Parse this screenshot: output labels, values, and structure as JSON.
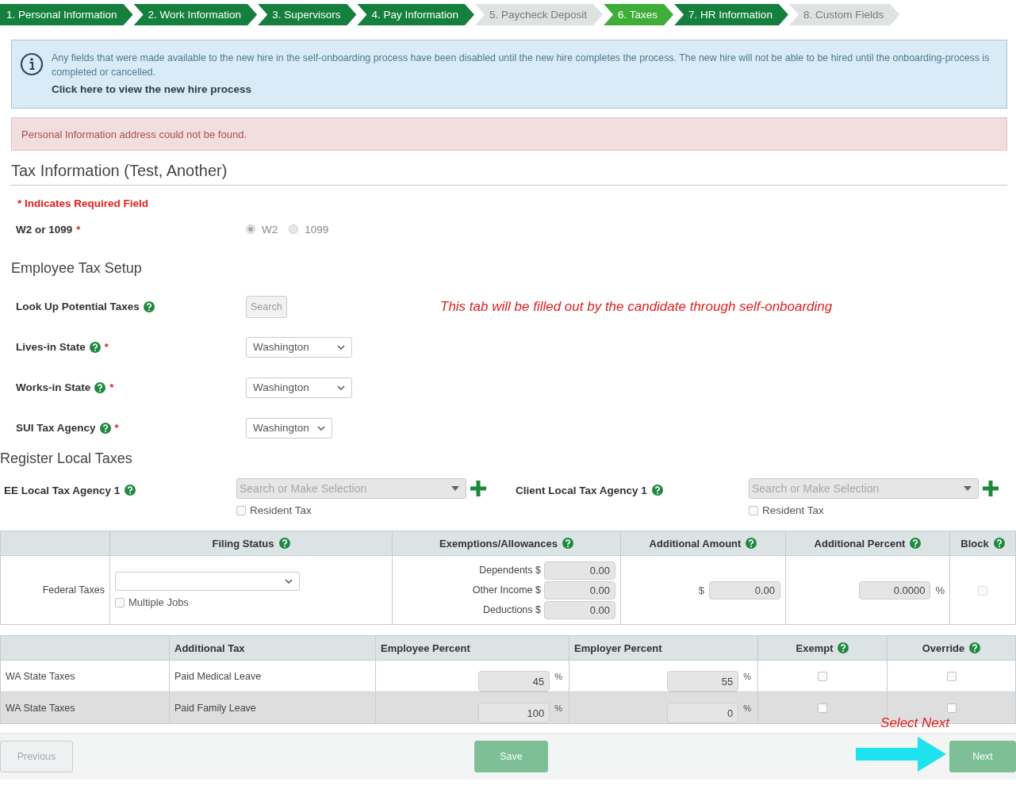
{
  "steps": [
    {
      "label": "1. Personal Information",
      "completed": true,
      "selected": false
    },
    {
      "label": "2. Work Information",
      "completed": true,
      "selected": false
    },
    {
      "label": "3. Supervisors",
      "completed": true,
      "selected": false
    },
    {
      "label": "4. Pay Information",
      "completed": true,
      "selected": false
    },
    {
      "label": "5. Paycheck Deposit",
      "completed": false,
      "selected": false
    },
    {
      "label": "6. Taxes",
      "completed": false,
      "selected": true
    },
    {
      "label": "7. HR Information",
      "completed": true,
      "selected": false
    },
    {
      "label": "8. Custom Fields",
      "completed": false,
      "selected": false
    }
  ],
  "info_alert": {
    "text": "Any fields that were made available to the new hire in the self-onboarding process have been disabled until the new hire completes the process. The new hire will not be able to be hired until the onboarding-process is completed or cancelled.",
    "link": "Click here to view the new hire process"
  },
  "error_alert": {
    "text": "Personal Information address could not be found."
  },
  "title": "Tax Information (Test, Another)",
  "required_note": "* Indicates Required Field",
  "worker_type": {
    "label": "W2 or 1099",
    "required_mark": "*",
    "options": [
      {
        "label": "W2",
        "selected": true,
        "disabled": true
      },
      {
        "label": "1099",
        "selected": false,
        "disabled": true
      }
    ]
  },
  "tax_setup": {
    "heading": "Employee Tax Setup",
    "note": "This tab will be filled out by the candidate through self-onboarding",
    "rows": [
      {
        "kind": "button",
        "label": "Look Up Potential Taxes",
        "help": true,
        "button": "Search"
      },
      {
        "kind": "select",
        "label": "Lives-in State",
        "help": true,
        "required_mark": "*",
        "value": "Washington"
      },
      {
        "kind": "select",
        "label": "Works-in State",
        "help": true,
        "required_mark": "*",
        "value": "Washington"
      },
      {
        "kind": "select",
        "label": "SUI Tax Agency",
        "help": true,
        "required_mark": "*",
        "value": "Washington"
      }
    ]
  },
  "local_taxes": {
    "heading": "Register Local Taxes",
    "agencies": [
      {
        "label": "EE Local Tax Agency 1",
        "help": true,
        "placeholder": "Search or Make Selection",
        "resident": {
          "label": "Resident Tax",
          "checked": false
        }
      },
      {
        "label": "Client Local Tax Agency 1",
        "help": true,
        "placeholder": "Search or Make Selection",
        "resident": {
          "label": "Resident Tax",
          "checked": false
        }
      }
    ]
  },
  "federal_table": {
    "columns": [
      {
        "label": "Filing Status",
        "help": true
      },
      {
        "label": "Exemptions/Allowances",
        "help": true
      },
      {
        "label": "Additional Amount",
        "help": true
      },
      {
        "label": "Additional Percent",
        "help": true
      },
      {
        "label": "Block",
        "help": true
      }
    ],
    "row": {
      "label": "Federal Taxes",
      "multiple_jobs": {
        "label": "Multiple Jobs",
        "checked": false
      },
      "exemptions": [
        {
          "label": "Dependents $",
          "value": "0.00"
        },
        {
          "label": "Other Income $",
          "value": "0.00"
        },
        {
          "label": "Deductions $",
          "value": "0.00"
        }
      ],
      "additional_amount": {
        "prefix": "$",
        "value": "0.00"
      },
      "additional_percent": {
        "value": "0.0000",
        "suffix": "%"
      },
      "block": false
    }
  },
  "state_table": {
    "columns": [
      {
        "label": "Additional Tax",
        "help": false
      },
      {
        "label": "Employee Percent",
        "help": false
      },
      {
        "label": "Employer Percent",
        "help": false
      },
      {
        "label": "Exempt",
        "help": true
      },
      {
        "label": "Override",
        "help": true
      }
    ],
    "rows": [
      {
        "label": "WA State Taxes",
        "additional_tax": "Paid Medical Leave",
        "employee_percent": "45",
        "employee_unit": "%",
        "employer_percent": "55",
        "employer_unit": "%",
        "exempt": false,
        "override": false,
        "highlighted": false
      },
      {
        "label": "WA State Taxes",
        "additional_tax": "Paid Family Leave",
        "employee_percent": "100",
        "employee_unit": "%",
        "employer_percent": "0",
        "employer_unit": "%",
        "exempt": false,
        "override": false,
        "highlighted": true
      }
    ]
  },
  "footer": {
    "buttons": [
      {
        "label": "Previous",
        "kind": "secondary",
        "disabled": true
      },
      {
        "label": "Save",
        "kind": "primary",
        "disabled": true
      },
      {
        "label": "Next",
        "kind": "primary",
        "disabled": true
      }
    ],
    "annotation": "Select Next"
  }
}
